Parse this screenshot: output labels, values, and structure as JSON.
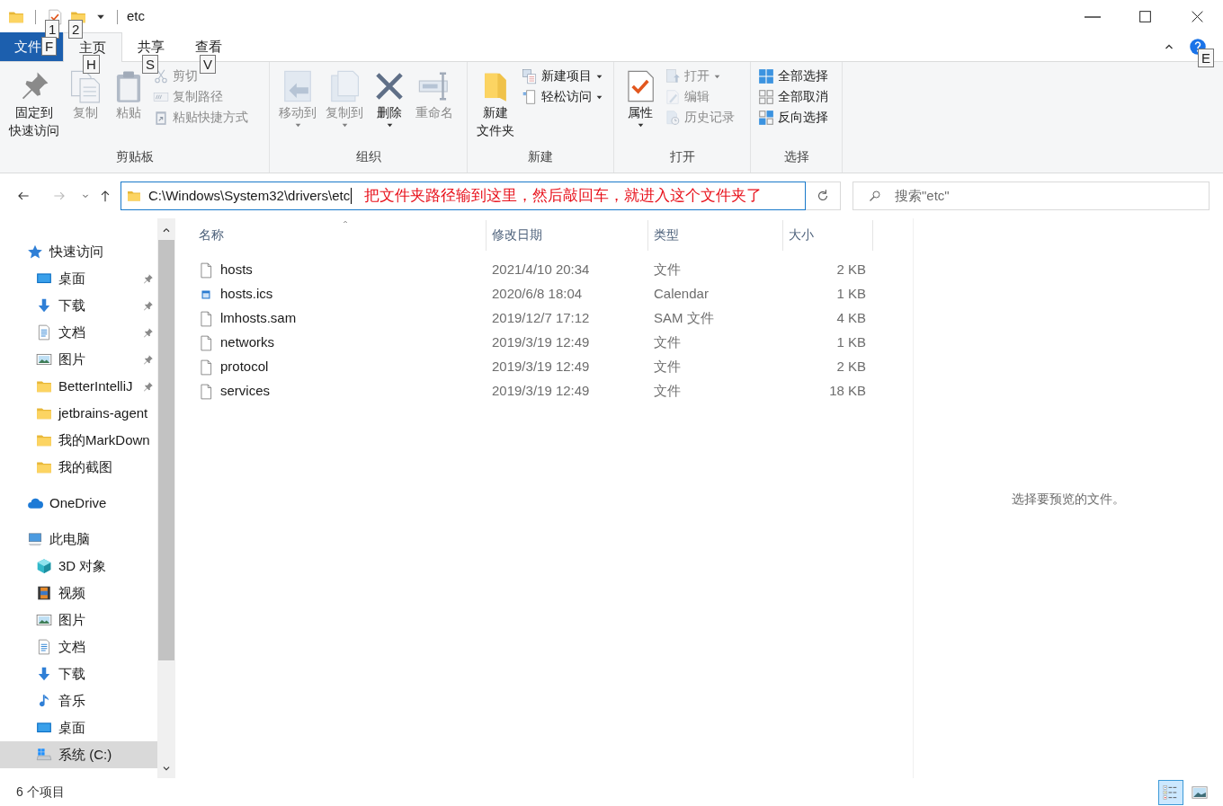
{
  "title_bar": {
    "quick_access": [
      {
        "kind": "properties",
        "keytip": "1"
      },
      {
        "kind": "folder",
        "keytip": "2"
      }
    ],
    "title": "etc"
  },
  "ribbon_tabs": [
    {
      "label": "文件",
      "kind": "file",
      "selected": false,
      "keytip": "F"
    },
    {
      "label": "主页",
      "kind": "tab",
      "selected": true,
      "keytip": "H"
    },
    {
      "label": "共享",
      "kind": "tab",
      "selected": false,
      "keytip": "S"
    },
    {
      "label": "查看",
      "kind": "tab",
      "selected": false,
      "keytip": "V"
    }
  ],
  "help": {
    "keytip": "E"
  },
  "ribbon_groups": [
    {
      "label": "剪贴板",
      "large_buttons": [
        {
          "kind": "pin",
          "label_lines": [
            "固定到",
            "快速访问"
          ],
          "disabled": false,
          "dropdown": false
        },
        {
          "kind": "copy",
          "label_lines": [
            "复制"
          ],
          "disabled": true,
          "dropdown": false
        },
        {
          "kind": "paste",
          "label_lines": [
            "粘贴"
          ],
          "disabled": true,
          "dropdown": false
        }
      ],
      "small_buttons": [
        {
          "kind": "cut",
          "label": "剪切",
          "disabled": true,
          "dropdown": false
        },
        {
          "kind": "copypath",
          "label": "复制路径",
          "disabled": true,
          "dropdown": false
        },
        {
          "kind": "pasteshortcut",
          "label": "粘贴快捷方式",
          "disabled": true,
          "dropdown": false
        }
      ]
    },
    {
      "label": "组织",
      "large_buttons": [
        {
          "kind": "moveto",
          "label_lines": [
            "移动到"
          ],
          "disabled": true,
          "dropdown": true
        },
        {
          "kind": "copyto",
          "label_lines": [
            "复制到"
          ],
          "disabled": true,
          "dropdown": true
        },
        {
          "kind": "delete",
          "label_lines": [
            "删除"
          ],
          "disabled": false,
          "dropdown": true
        },
        {
          "kind": "rename",
          "label_lines": [
            "重命名"
          ],
          "disabled": true,
          "dropdown": false
        }
      ]
    },
    {
      "label": "新建",
      "large_buttons": [
        {
          "kind": "newfolder",
          "label_lines": [
            "新建",
            "文件夹"
          ],
          "disabled": false,
          "dropdown": false
        }
      ],
      "small_buttons": [
        {
          "kind": "newitem",
          "label": "新建项目",
          "disabled": false,
          "dropdown": true
        },
        {
          "kind": "easyaccess",
          "label": "轻松访问",
          "disabled": false,
          "dropdown": true
        }
      ]
    },
    {
      "label": "打开",
      "large_buttons": [
        {
          "kind": "properties",
          "label_lines": [
            "属性"
          ],
          "disabled": false,
          "dropdown": true
        }
      ],
      "small_buttons": [
        {
          "kind": "open",
          "label": "打开",
          "disabled": true,
          "dropdown": true
        },
        {
          "kind": "edit",
          "label": "编辑",
          "disabled": true,
          "dropdown": false
        },
        {
          "kind": "history",
          "label": "历史记录",
          "disabled": true,
          "dropdown": false
        }
      ]
    },
    {
      "label": "选择",
      "small_buttons": [
        {
          "kind": "selectall",
          "label": "全部选择",
          "disabled": false,
          "dropdown": false
        },
        {
          "kind": "selectnone",
          "label": "全部取消",
          "disabled": false,
          "dropdown": false
        },
        {
          "kind": "invert",
          "label": "反向选择",
          "disabled": false,
          "dropdown": false
        }
      ]
    }
  ],
  "address_bar": {
    "path": "C:\\Windows\\System32\\drivers\\etc",
    "annotation": "把文件夹路径输到这里，然后敲回车，就进入这个文件夹了"
  },
  "search": {
    "placeholder": "搜索\"etc\""
  },
  "navigation_pane": {
    "items": [
      {
        "label": "快速访问",
        "kind": "star",
        "selected": false,
        "children": [
          {
            "label": "桌面",
            "kind": "desktop",
            "selected": false,
            "pinned": true
          },
          {
            "label": "下载",
            "kind": "download",
            "selected": false,
            "pinned": true
          },
          {
            "label": "文档",
            "kind": "document",
            "selected": false,
            "pinned": true
          },
          {
            "label": "图片",
            "kind": "picture",
            "selected": false,
            "pinned": true
          },
          {
            "label": "BetterIntelliJ",
            "kind": "folder",
            "selected": false,
            "pinned": true
          },
          {
            "label": "jetbrains-agent",
            "kind": "folder",
            "selected": false,
            "pinned": false
          },
          {
            "label": "我的MarkDown",
            "kind": "folder",
            "selected": false,
            "pinned": false
          },
          {
            "label": "我的截图",
            "kind": "folder",
            "selected": false,
            "pinned": false
          }
        ]
      },
      {
        "label": "OneDrive",
        "kind": "cloud",
        "selected": false
      },
      {
        "label": "此电脑",
        "kind": "pc",
        "selected": false,
        "children": [
          {
            "label": "3D 对象",
            "kind": "cube",
            "selected": false
          },
          {
            "label": "视频",
            "kind": "video",
            "selected": false
          },
          {
            "label": "图片",
            "kind": "picture",
            "selected": false
          },
          {
            "label": "文档",
            "kind": "document",
            "selected": false
          },
          {
            "label": "下载",
            "kind": "download",
            "selected": false
          },
          {
            "label": "音乐",
            "kind": "music",
            "selected": false
          },
          {
            "label": "桌面",
            "kind": "desktop",
            "selected": false
          },
          {
            "label": "系统 (C:)",
            "kind": "drive",
            "selected": true
          }
        ]
      }
    ]
  },
  "file_list": {
    "columns": [
      {
        "label": "名称",
        "sorted": true
      },
      {
        "label": "修改日期",
        "sorted": false
      },
      {
        "label": "类型",
        "sorted": false
      },
      {
        "label": "大小",
        "sorted": false
      }
    ],
    "rows": [
      {
        "kind": "file",
        "name": "hosts",
        "modified": "2021/4/10 20:34",
        "type": "文件",
        "size": "2 KB",
        "selected": false
      },
      {
        "kind": "calendar",
        "name": "hosts.ics",
        "modified": "2020/6/8 18:04",
        "type": "Calendar",
        "size": "1 KB",
        "selected": false
      },
      {
        "kind": "file",
        "name": "lmhosts.sam",
        "modified": "2019/12/7 17:12",
        "type": "SAM 文件",
        "size": "4 KB",
        "selected": false
      },
      {
        "kind": "file",
        "name": "networks",
        "modified": "2019/3/19 12:49",
        "type": "文件",
        "size": "1 KB",
        "selected": false
      },
      {
        "kind": "file",
        "name": "protocol",
        "modified": "2019/3/19 12:49",
        "type": "文件",
        "size": "2 KB",
        "selected": false
      },
      {
        "kind": "file",
        "name": "services",
        "modified": "2019/3/19 12:49",
        "type": "文件",
        "size": "18 KB",
        "selected": false
      }
    ]
  },
  "preview_pane": {
    "message": "选择要预览的文件。"
  },
  "status_bar": {
    "item_count": "6 个项目",
    "views": [
      {
        "kind": "details",
        "selected": true
      },
      {
        "kind": "preview",
        "selected": false
      }
    ]
  }
}
